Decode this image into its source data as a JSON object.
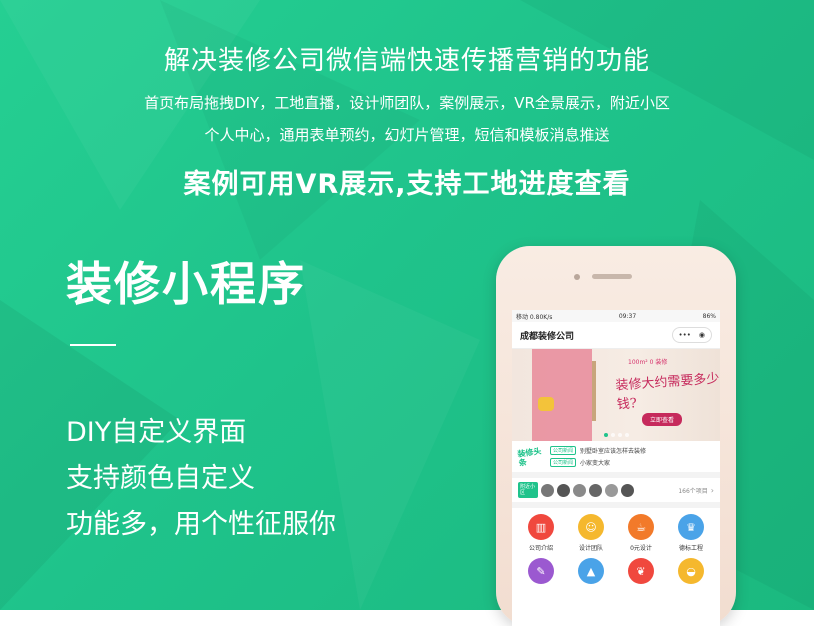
{
  "headline": "解决装修公司微信端快速传播营销的功能",
  "features_line1": "首页布局拖拽DIY，工地直播，设计师团队，案例展示，VR全景展示，附近小区",
  "features_line2": "个人中心，通用表单预约，幻灯片管理，短信和模板消息推送",
  "highlight": "案例可用VR展示,支持工地进度查看",
  "product_title": "装修小程序",
  "selling_points": [
    "DIY自定义界面",
    "支持颜色自定义",
    "功能多，用个性征服你"
  ],
  "colors": {
    "brand": "#1fc38b",
    "banner_accent": "#c62a5c"
  },
  "phone": {
    "status_left": "移动 0.80K/s",
    "status_time": "09:37",
    "status_right": "86%",
    "app_title": "成都装修公司",
    "capsule_more": "•••",
    "banner": {
      "small": "100m² 0  装修",
      "title": "装修大约需要多少钱?",
      "cta": "立即查看"
    },
    "news": {
      "logo": "装修头条",
      "items": [
        {
          "tag": "公司新闻",
          "text": "别墅卧室应该怎样去装修"
        },
        {
          "tag": "公司新闻",
          "text": "小家变大家"
        }
      ]
    },
    "community": {
      "zone": "附近小区",
      "count": "166个项目"
    },
    "menu": [
      {
        "label": "公司介绍",
        "icon": "building-icon",
        "color": "#f0483e"
      },
      {
        "label": "设计团队",
        "icon": "team-icon",
        "color": "#f5b82e"
      },
      {
        "label": "0元设计",
        "icon": "cup-icon",
        "color": "#f27a2a"
      },
      {
        "label": "德标工程",
        "icon": "crown-icon",
        "color": "#4aa3e8"
      },
      {
        "label": "",
        "icon": "doc-icon",
        "color": "#9b59d0"
      },
      {
        "label": "",
        "icon": "tree-icon",
        "color": "#4aa3e8"
      },
      {
        "label": "",
        "icon": "lungs-icon",
        "color": "#f0483e"
      },
      {
        "label": "",
        "icon": "dish-icon",
        "color": "#f5b82e"
      }
    ]
  }
}
